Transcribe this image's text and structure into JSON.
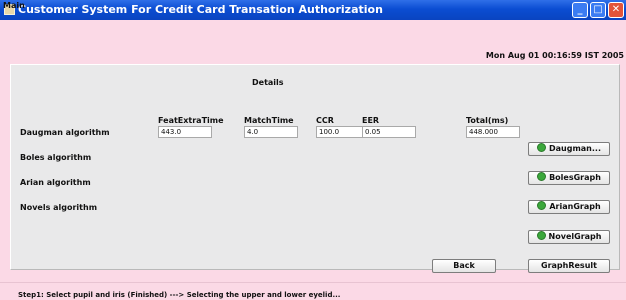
{
  "window": {
    "title": "Customer System For Credit Card Transation Authorization"
  },
  "menu": {
    "main": "Main"
  },
  "header": {
    "date": "Mon Aug 01 00:16:59 IST 2005"
  },
  "panel": {
    "title": "Details",
    "columns": [
      "FeatExtraTime",
      "MatchTime",
      "CCR",
      "EER",
      "Total(ms)"
    ],
    "rows": [
      {
        "label": "Daugman algorithm",
        "values": [
          "443.0",
          "4.0",
          "100.0",
          "0.05",
          "448.000"
        ]
      },
      {
        "label": "Boles algorithm"
      },
      {
        "label": "Arian algorithm"
      },
      {
        "label": "Novels algorithm"
      }
    ],
    "buttons": {
      "daugman": "Daugman...",
      "boles": "BolesGraph",
      "arian": "ArianGraph",
      "novel": "NovelGraph",
      "back": "Back",
      "graph_result": "GraphResult"
    }
  },
  "status": "Step1: Select pupil and iris (Finished) ---> Selecting the upper and lower eyelid...",
  "colors": {
    "title_bar": "#0b4dd2",
    "background": "#fbd9e6",
    "panel": "#e9e9ea",
    "icon_green": "#3ca83c"
  }
}
